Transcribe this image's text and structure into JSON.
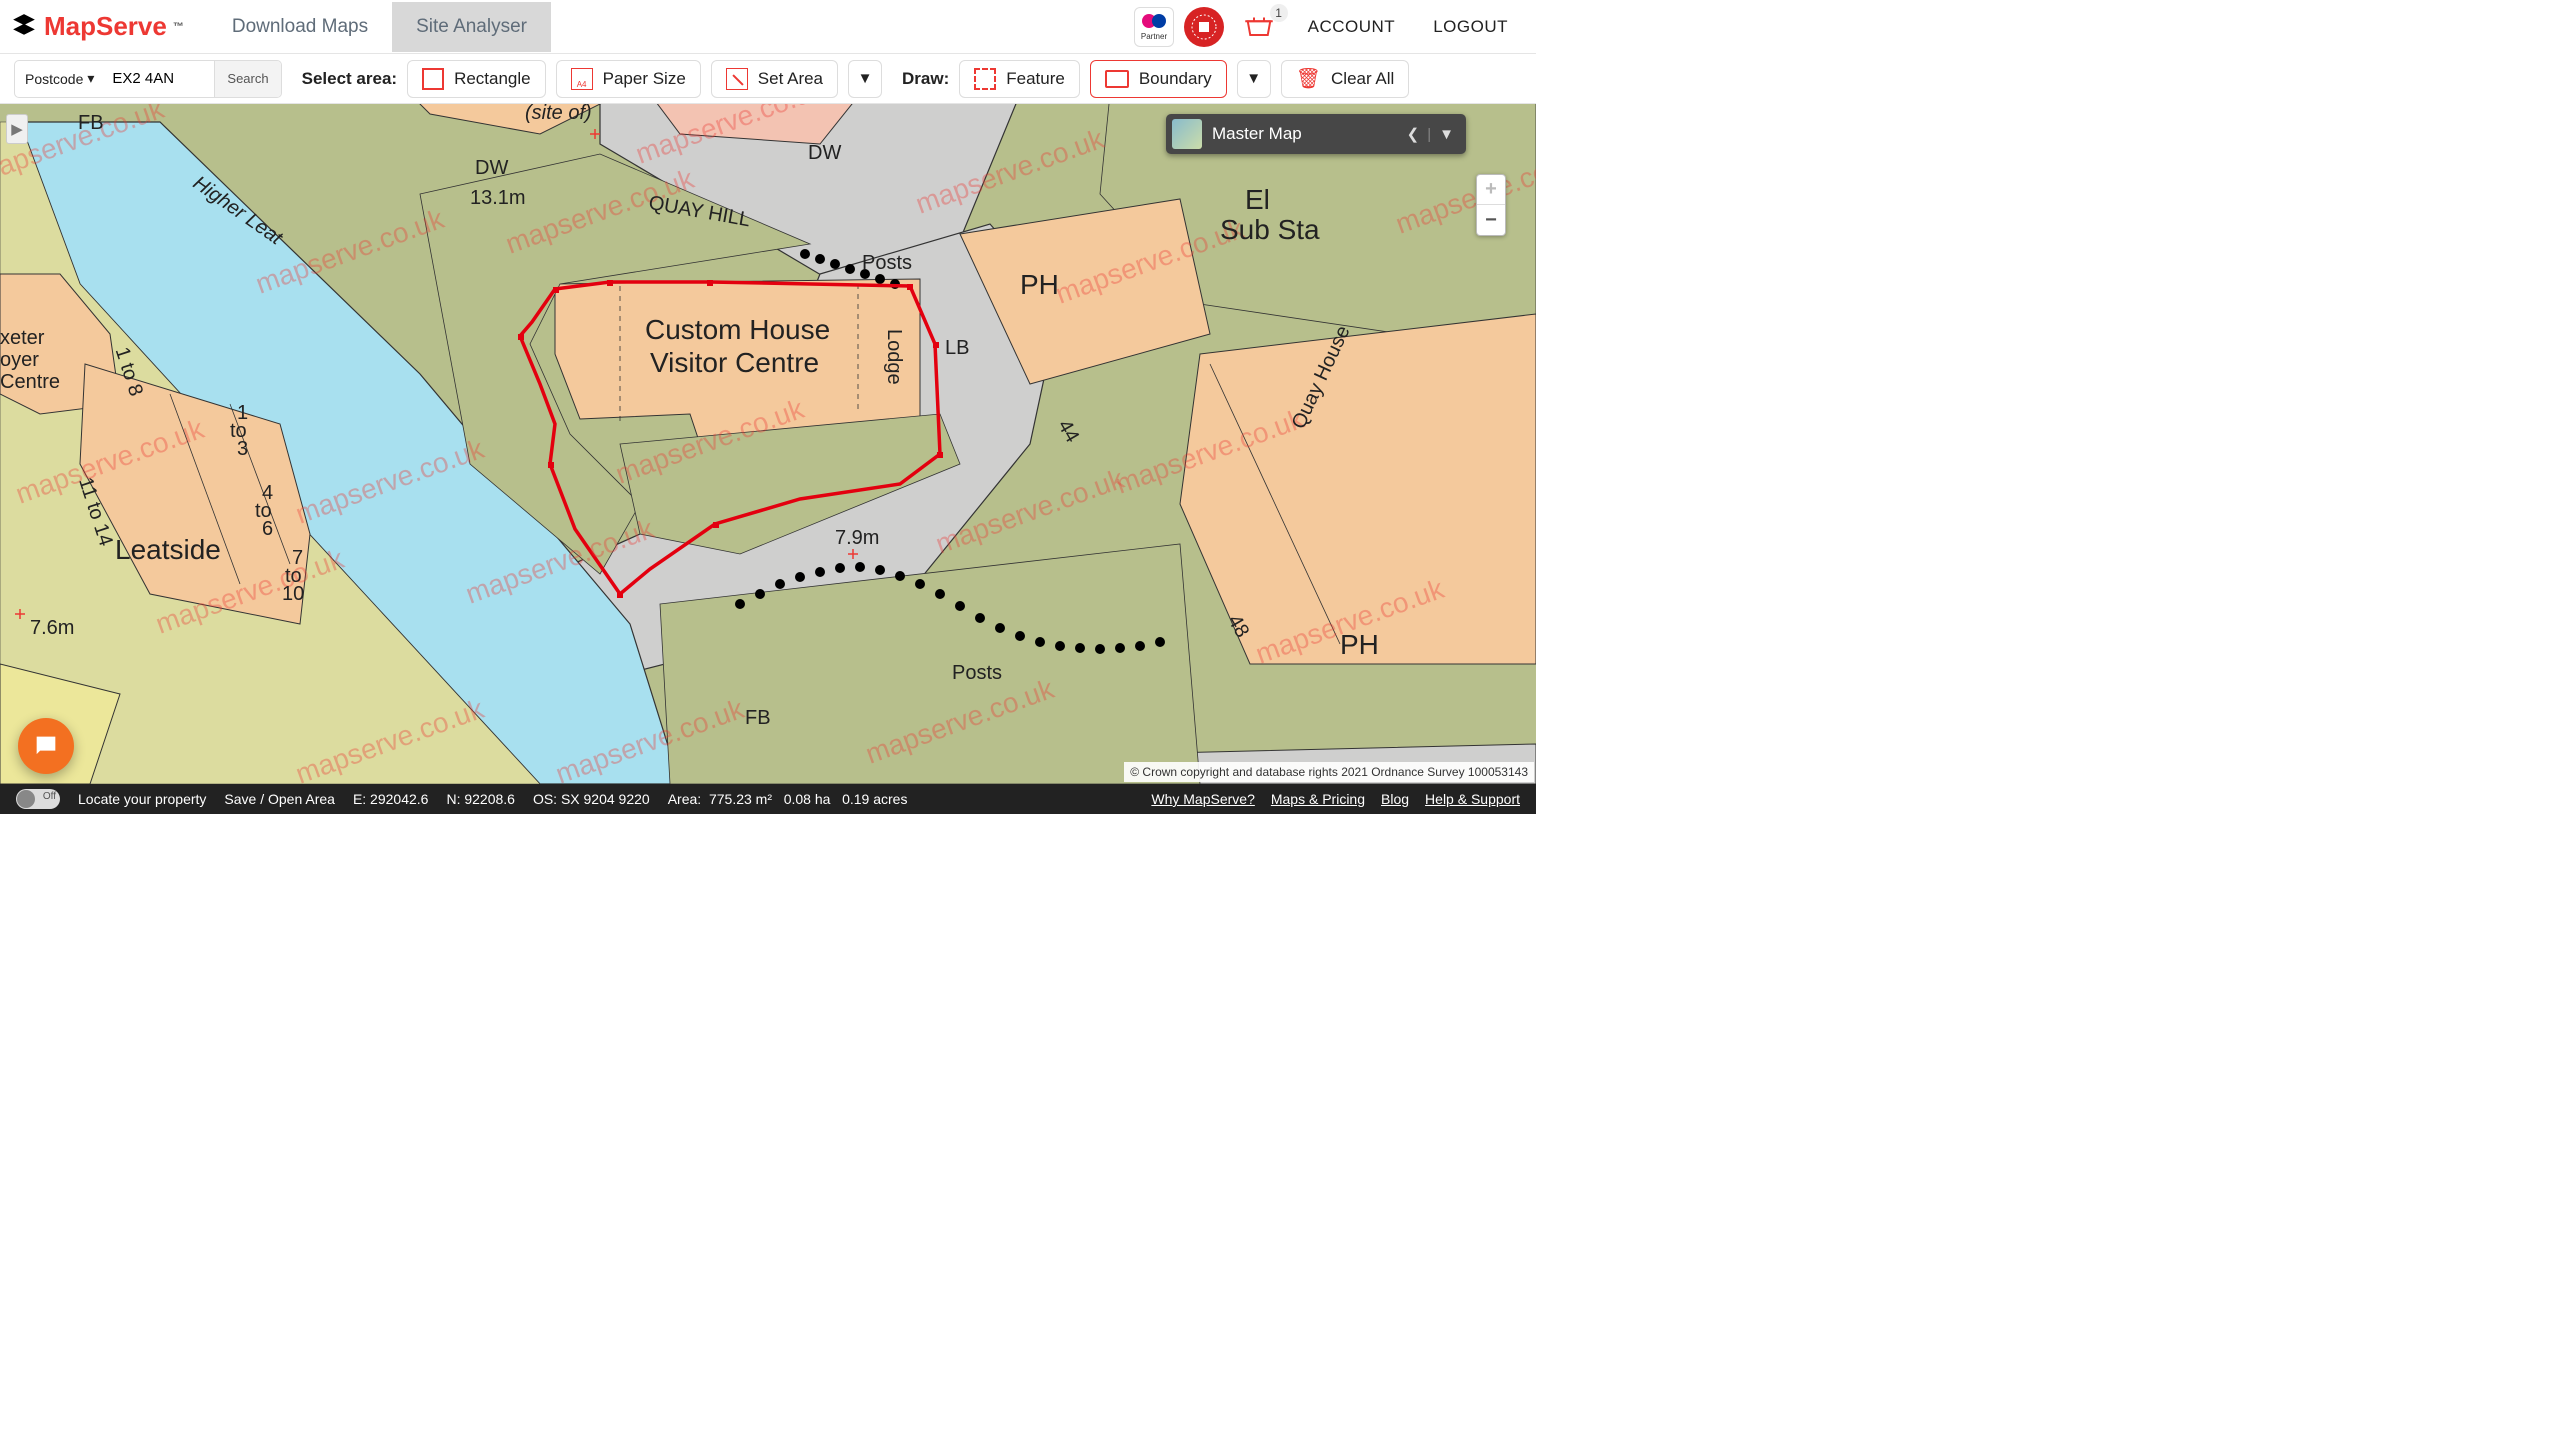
{
  "header": {
    "logo_text": "MapServe",
    "logo_tm": "™",
    "tabs": {
      "download": "Download Maps",
      "analyser": "Site Analyser"
    },
    "os_label": "Partner",
    "basket_count": "1",
    "account": "ACCOUNT",
    "logout": "LOGOUT"
  },
  "toolbar": {
    "search_type": "Postcode",
    "search_value": "EX2 4AN",
    "search_btn": "Search",
    "select_label": "Select area:",
    "rectangle": "Rectangle",
    "paper_size": "Paper Size",
    "set_area": "Set Area",
    "draw_label": "Draw:",
    "feature": "Feature",
    "boundary": "Boundary",
    "clear": "Clear All"
  },
  "map": {
    "layer_name": "Master Map",
    "attribution": "© Crown copyright and database rights 2021 Ordnance Survey 100053143",
    "watermark": "mapserve.co.uk",
    "labels": {
      "fb1": "FB",
      "fb2": "FB",
      "dw1": "DW",
      "dw2": "DW",
      "siteof": "(site of)",
      "higher_leat": "Higher Leat",
      "quay_hill": "QUAY HILL",
      "spot_131": "13.1m",
      "spot_79": "7.9m",
      "spot_76": "7.6m",
      "posts1": "Posts",
      "posts2": "Posts",
      "custom1": "Custom House",
      "custom2": "Visitor Centre",
      "lodge": "Lodge",
      "lb": "LB",
      "ph1": "PH",
      "ph2": "PH",
      "substa1": "El",
      "substa2": "Sub Sta",
      "quay_house": "Quay House",
      "n44": "44",
      "n48": "48",
      "leatside": "Leatside",
      "n1to8": "1 to 8",
      "n11to14": "11 to 14",
      "n1to3_1": "1",
      "n1to3_to": "to",
      "n1to3_3": "3",
      "n4to6_4": "4",
      "n4to6_to": "to",
      "n4to6_6": "6",
      "n7to10_7": "7",
      "n7to10_to": "to",
      "n7to10_10": "10",
      "xeter1": "xeter",
      "xeter2": "oyer",
      "xeter3": "Centre"
    }
  },
  "footer": {
    "locate": "Locate your property",
    "save": "Save / Open Area",
    "easting": "E: 292042.6",
    "northing": "N: 92208.6",
    "os_grid": "OS: SX 9204 9220",
    "area_lbl": "Area:",
    "area_m2": "775.23 m²",
    "area_ha": "0.08 ha",
    "area_ac": "0.19 acres",
    "links": {
      "why": "Why MapServe?",
      "pricing": "Maps & Pricing",
      "blog": "Blog",
      "help": "Help & Support"
    },
    "toggle_off": "Off"
  }
}
